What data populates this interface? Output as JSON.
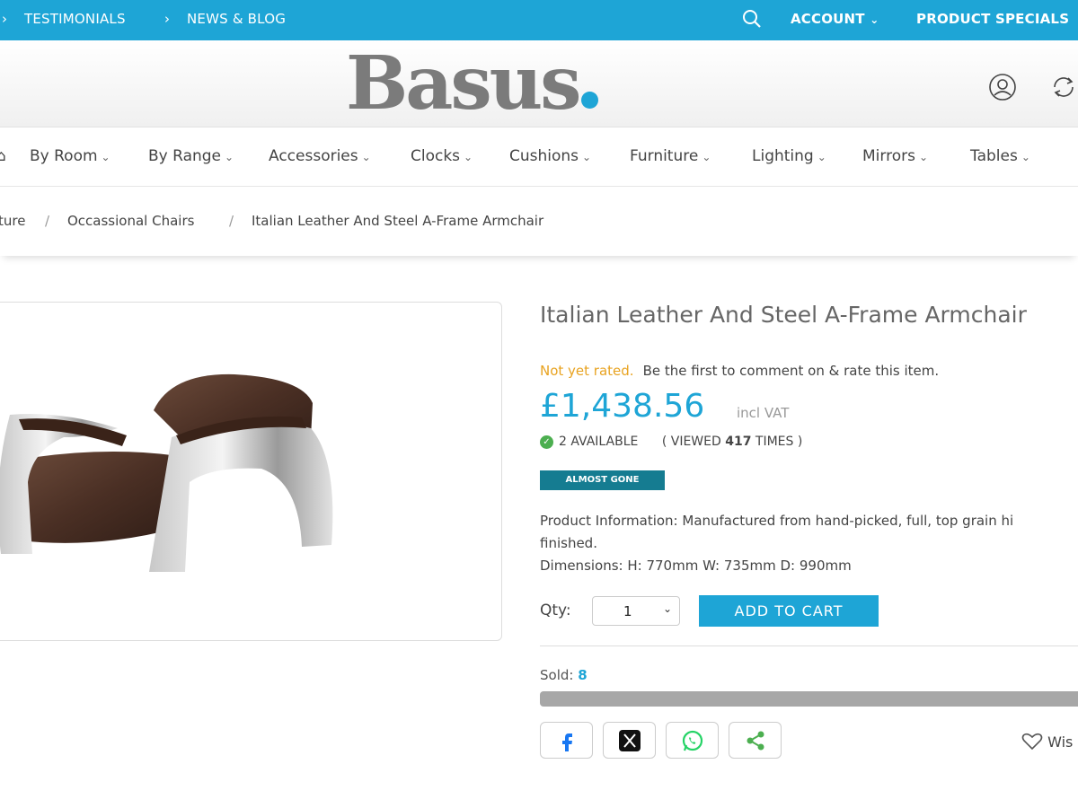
{
  "topbar": {
    "links": [
      "TESTIMONIALS",
      "NEWS & BLOG"
    ],
    "account": "ACCOUNT",
    "specials": "PRODUCT SPECIALS",
    "icons": [
      "search-icon"
    ]
  },
  "header": {
    "logo": "Basus",
    "icons": [
      "user-icon",
      "refresh-icon"
    ]
  },
  "nav": {
    "items": [
      "By Room",
      "By Range",
      "Accessories",
      "Clocks",
      "Cushions",
      "Furniture",
      "Lighting",
      "Mirrors",
      "Tables"
    ]
  },
  "breadcrumb": {
    "items": [
      "ture",
      "Occassional Chairs",
      "Italian Leather And Steel A-Frame Armchair"
    ],
    "separator": "/"
  },
  "product": {
    "title": "Italian Leather And Steel A-Frame Armchair",
    "rating_status": "Not yet rated.",
    "rating_prompt": "Be the first to comment on & rate this item.",
    "price": "£1,438.56",
    "vat": "incl VAT",
    "available": "2 AVAILABLE",
    "viewed_prefix": "( VIEWED ",
    "viewed_count": "417",
    "viewed_suffix": " TIMES )",
    "badge": "ALMOST GONE",
    "description": "Product Information: Manufactured from hand-picked, full, top grain hi",
    "description_cont": "finished.",
    "dimensions": "Dimensions: H: 770mm W: 735mm D: 990mm",
    "qty_label": "Qty:",
    "qty_value": "1",
    "add_to_cart": "ADD TO CART",
    "sold_label": "Sold:",
    "sold_count": "8",
    "sold_fraction": 1.0,
    "wishlist": "Wis"
  },
  "share": {
    "icons": [
      "facebook-icon",
      "x-icon",
      "whatsapp-icon",
      "share-icon"
    ]
  },
  "colors": {
    "brand_blue": "#1ea5d6",
    "badge_teal": "#157c91",
    "rating_orange": "#e8a321",
    "available_green": "#4caf50"
  }
}
